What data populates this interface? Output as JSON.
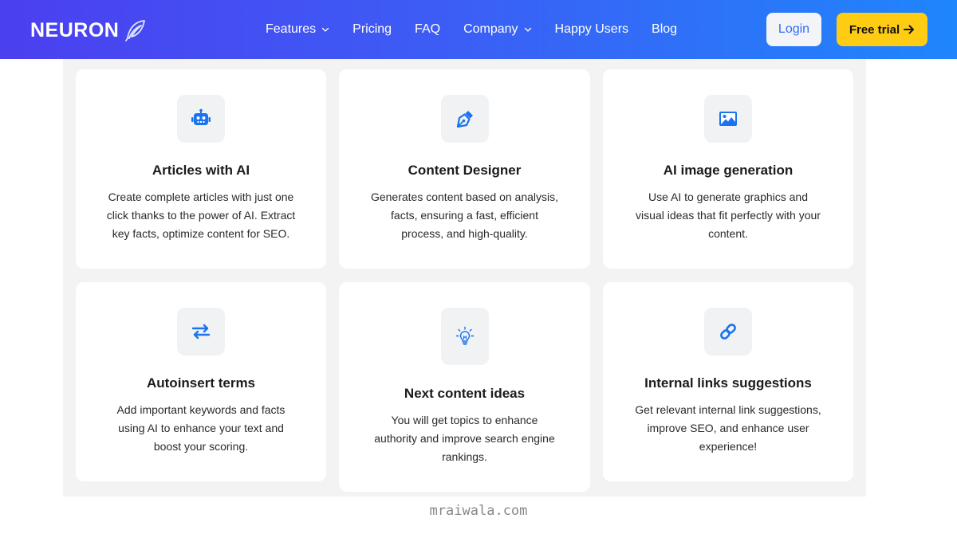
{
  "header": {
    "logo_text": "NEURON",
    "nav": [
      {
        "label": "Features",
        "dropdown": true
      },
      {
        "label": "Pricing",
        "dropdown": false
      },
      {
        "label": "FAQ",
        "dropdown": false
      },
      {
        "label": "Company",
        "dropdown": true
      },
      {
        "label": "Happy Users",
        "dropdown": false
      },
      {
        "label": "Blog",
        "dropdown": false
      }
    ],
    "login_label": "Login",
    "trial_label": "Free trial"
  },
  "features": [
    {
      "icon": "robot-icon",
      "title": "Articles with AI",
      "lines": [
        "Create complete articles with just one",
        "click thanks to the power of AI. Extract",
        "key facts, optimize content for SEO."
      ]
    },
    {
      "icon": "pen-nib-icon",
      "title": "Content Designer",
      "lines": [
        "Generates content based on analysis,",
        "facts, ensuring a fast, efficient",
        "process, and high-quality."
      ]
    },
    {
      "icon": "image-icon",
      "title": "AI image generation",
      "lines": [
        "Use AI to generate graphics and",
        "visual ideas that fit perfectly with your",
        "content."
      ]
    },
    {
      "icon": "swap-arrows-icon",
      "title": "Autoinsert terms",
      "lines": [
        "Add important keywords and facts",
        "using AI to enhance your text and",
        "boost your scoring."
      ]
    },
    {
      "icon": "lightbulb-icon",
      "title": "Next content ideas",
      "lines": [
        "You will get topics to enhance",
        "authority and improve search engine",
        "rankings."
      ]
    },
    {
      "icon": "link-icon",
      "title": "Internal links suggestions",
      "lines": [
        "Get relevant internal link suggestions,",
        "improve SEO, and enhance user",
        "experience!"
      ]
    }
  ],
  "watermark": "mraiwala.com",
  "colors": {
    "accent": "#1a73f0",
    "trial": "#ffcc14",
    "login_text": "#2f6df6"
  }
}
